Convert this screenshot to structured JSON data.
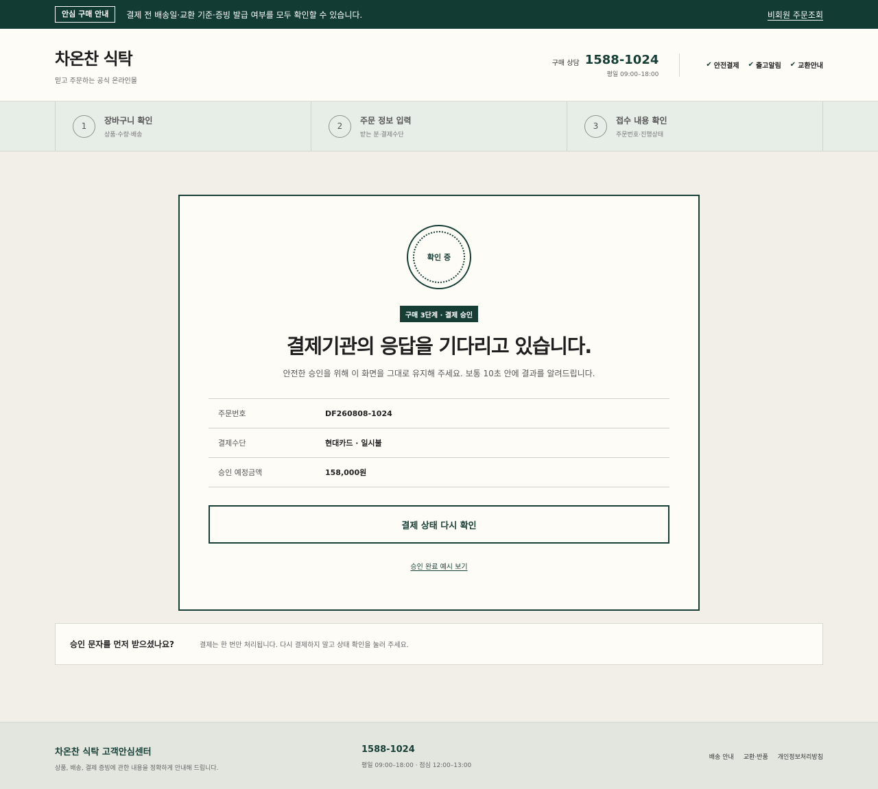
{
  "notice": {
    "badge": "안심 구매 안내",
    "text": "결제 전 배송일·교환 기준·증빙 발급 여부를 모두 확인할 수 있습니다.",
    "link": "비회원 주문조회"
  },
  "header": {
    "brand": "차온찬 식탁",
    "tagline": "믿고 주문하는 공식 온라인몰",
    "contact_label": "구매 상담",
    "phone": "1588-1024",
    "hours": "평일 09:00–18:00",
    "assurances": [
      "안전결제",
      "출고알림",
      "교환안내"
    ]
  },
  "steps": [
    {
      "num": "1",
      "title": "장바구니 확인",
      "desc": "상품·수량·배송"
    },
    {
      "num": "2",
      "title": "주문 정보 입력",
      "desc": "받는 분·결제수단"
    },
    {
      "num": "3",
      "title": "접수 내용 확인",
      "desc": "주문번호·진행상태"
    }
  ],
  "card": {
    "spinner_text": "확인 중",
    "stage_badge": "구매 3단계 · 결제 승인",
    "headline": "결제기관의 응답을 기다리고 있습니다.",
    "subline": "안전한 승인을 위해 이 화면을 그대로 유지해 주세요. 보통 10초 안에 결과를 알려드립니다.",
    "rows": [
      {
        "label": "주문번호",
        "value": "DF260808-1024"
      },
      {
        "label": "결제수단",
        "value": "현대카드 · 일시불"
      },
      {
        "label": "승인 예정금액",
        "value": "158,000원"
      }
    ],
    "recheck_button": "결제 상태 다시 확인",
    "example_link": "승인 완료 예시 보기"
  },
  "help": {
    "title": "승인 문자를 먼저 받으셨나요?",
    "text": "결제는 한 번만 처리됩니다. 다시 결제하지 말고 상태 확인을 눌러 주세요."
  },
  "footer": {
    "title": "차온찬 식탁 고객안심센터",
    "desc": "상품, 배송, 결제 증빙에 관한 내용을 정확하게 안내해 드립니다.",
    "phone": "1588-1024",
    "hours": "평일 09:00–18:00 · 점심 12:00–13:00",
    "links": [
      "배송 안내",
      "교환·반품",
      "개인정보처리방침"
    ]
  },
  "colors": {
    "brand_green": "#163e35",
    "notice_bg": "#113b33",
    "page_bg": "#f2efe9",
    "card_bg": "#fdfcf7"
  }
}
